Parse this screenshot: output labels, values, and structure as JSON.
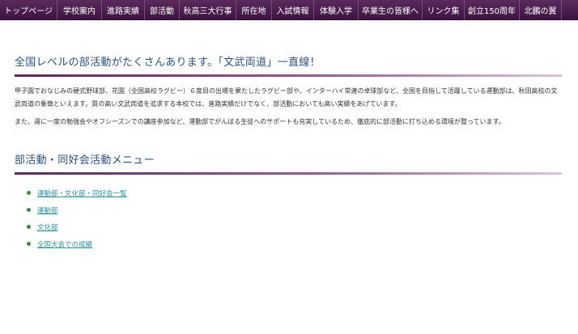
{
  "nav": {
    "items": [
      {
        "label": "トップページ"
      },
      {
        "label": "学校案内"
      },
      {
        "label": "進路実績"
      },
      {
        "label": "部活動"
      },
      {
        "label": "秋高三大行事"
      },
      {
        "label": "所在地"
      },
      {
        "label": "入試情報"
      },
      {
        "label": "体験入学"
      },
      {
        "label": "卒業生の皆様へ"
      },
      {
        "label": "リンク集"
      },
      {
        "label": "創立150周年"
      },
      {
        "label": "北鵬の翼"
      }
    ]
  },
  "intro": {
    "title": "全国レベルの部活動がたくさんあります。「文武両道」一直線！",
    "paragraph1": "甲子園でおなじみの硬式野球部、花園（全国高校ラグビー）６度目の出場を果たしたラグビー部や、インターハイ常連の卓球部など、全国を目指して活躍している運動部は、秋田高校の文武両道の象徴といえます。質の高い文武両道を追求する本校では、進路実績だけでなく、部活動においても高い実績をあげています。",
    "paragraph2": "また、週に一度の勉強会やオフシーズンでの講座参加など、運動部でがんばる生徒へのサポートも充実しているため、徹底的に部活動に打ち込める環境が整っています。"
  },
  "menu": {
    "title": "部活動・同好会活動メニュー",
    "links": [
      {
        "label": "運動部・文化部・同好会一覧"
      },
      {
        "label": "運動部"
      },
      {
        "label": "文化部"
      },
      {
        "label": "全国大会での成績"
      }
    ]
  },
  "colors": {
    "nav_background": "#4a1e4d",
    "title_text": "#2d4f7c",
    "link_text": "#2f8f9b",
    "bullet": "#3a8a4e"
  }
}
